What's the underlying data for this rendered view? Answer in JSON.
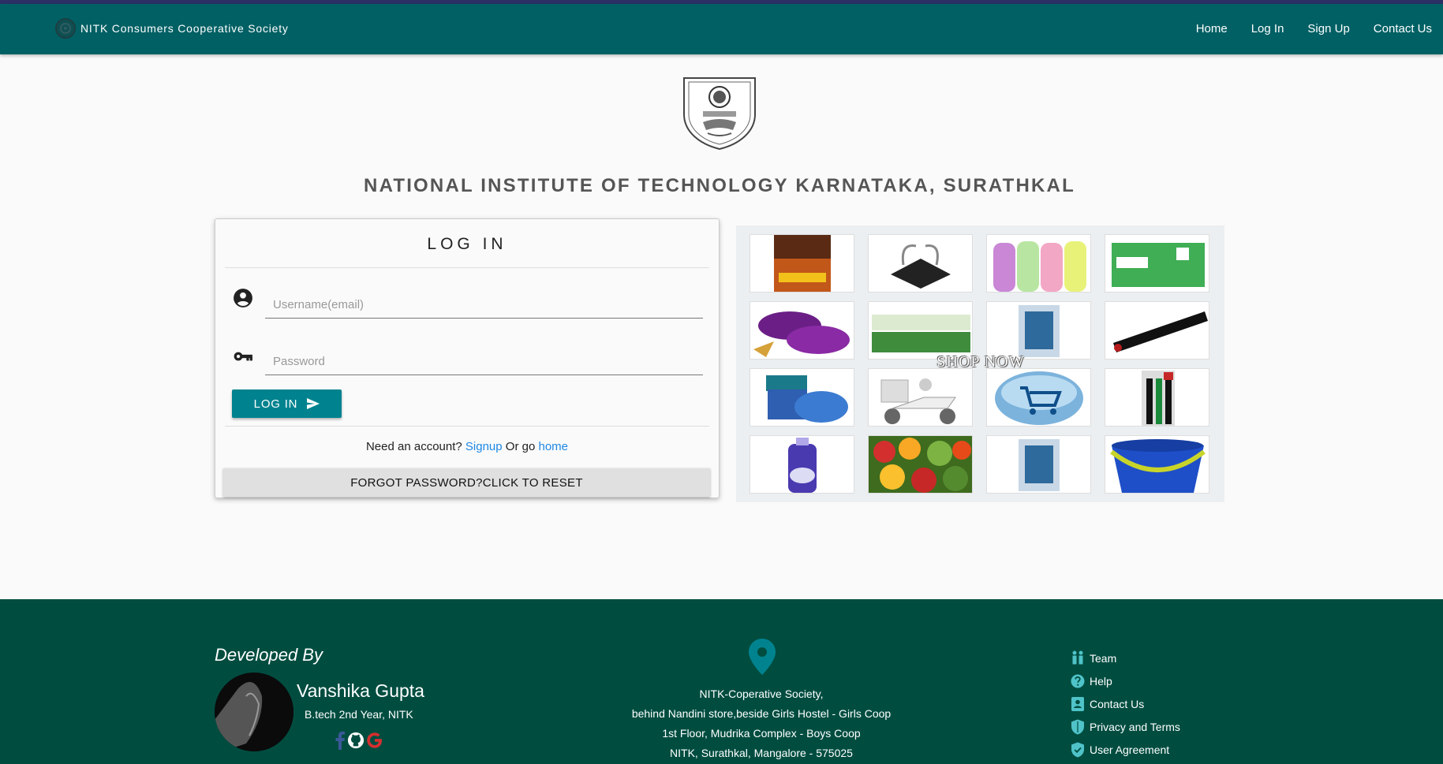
{
  "colors": {
    "navbar": "#006064",
    "footer": "#004d40",
    "button": "#00838f",
    "link": "#1e88e5"
  },
  "navbar": {
    "brand": "NITK Consumers Cooperative Society",
    "links": [
      "Home",
      "Log In",
      "Sign Up",
      "Contact Us"
    ]
  },
  "header": {
    "institute": "NATIONAL INSTITUTE OF TECHNOLOGY KARNATAKA, SURATHKAL"
  },
  "login": {
    "title": "LOG IN",
    "username_placeholder": "Username(email)",
    "password_placeholder": "Password",
    "submit_label": "LOG IN",
    "account_prompt": "Need an account?",
    "signup_link": "Signup",
    "or_go": "Or go",
    "home_link": "home",
    "forgot_label": "FORGOT PASSWORD?CLICK TO RESET"
  },
  "shop": {
    "overlay_text": "SHOP NOW",
    "tiles": [
      "nacho-crisps",
      "binder-clips",
      "water-bottles",
      "soap-pack",
      "eclairs-candy",
      "neem-toothpaste",
      "razor-pack",
      "pen-bag",
      "vaporub-jar",
      "delivery-scooter",
      "cart-button",
      "pens-pack",
      "detergent-bottle",
      "vegetables",
      "razor-pack",
      "bucket"
    ]
  },
  "footer": {
    "developed_by": "Developed By",
    "developer_name": "Vanshika Gupta",
    "developer_role": "B.tech 2nd Year, NITK",
    "address_lines": [
      "NITK-Coperative Society,",
      "behind Nandini store,beside Girls Hostel - Girls Coop",
      "1st Floor, Mudrika Complex - Boys Coop",
      "NITK, Surathkal, Mangalore - 575025"
    ],
    "links": [
      "Team",
      "Help",
      "Contact Us",
      "Privacy and Terms",
      "User Agreement"
    ]
  }
}
